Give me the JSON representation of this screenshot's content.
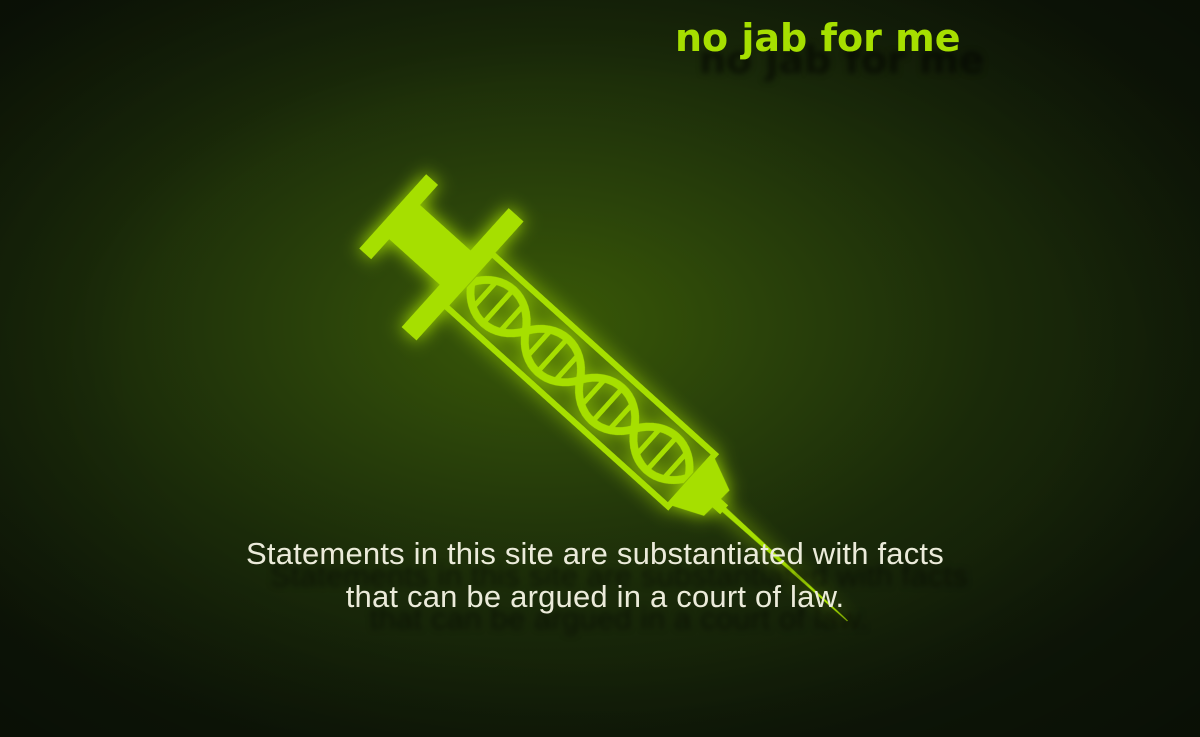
{
  "header": {
    "title": "no jab for me"
  },
  "hero": {
    "icon": "dna-syringe-icon",
    "accent_color": "#a6df00",
    "statement_lines": [
      "Statements in this site are substantiated with facts",
      "that can be argued in a court of law."
    ]
  }
}
